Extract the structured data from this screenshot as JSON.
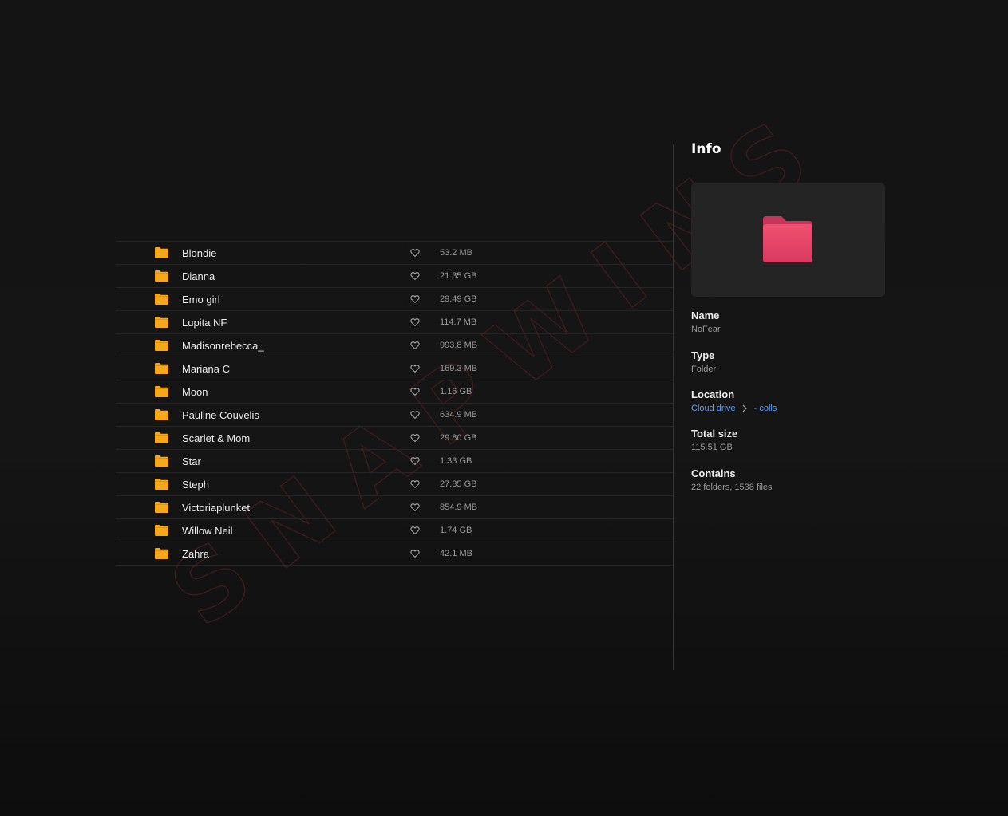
{
  "files": [
    {
      "name": "Blondie",
      "size": "53.2 MB"
    },
    {
      "name": "Dianna",
      "size": "21.35 GB"
    },
    {
      "name": "Emo girl",
      "size": "29.49 GB"
    },
    {
      "name": "Lupita NF",
      "size": "114.7 MB"
    },
    {
      "name": "Madisonrebecca_",
      "size": "993.8 MB"
    },
    {
      "name": "Mariana C",
      "size": "169.3 MB"
    },
    {
      "name": "Moon",
      "size": "1.16 GB"
    },
    {
      "name": "Pauline Couvelis",
      "size": "634.9 MB"
    },
    {
      "name": "Scarlet & Mom",
      "size": "29.80 GB"
    },
    {
      "name": "Star",
      "size": "1.33 GB"
    },
    {
      "name": "Steph",
      "size": "27.85 GB"
    },
    {
      "name": "Victoriaplunket",
      "size": "854.9 MB"
    },
    {
      "name": "Willow Neil",
      "size": "1.74 GB"
    },
    {
      "name": "Zahra",
      "size": "42.1 MB"
    }
  ],
  "icons": {
    "row_folder": "folder-icon",
    "row_favorite": "heart-icon",
    "preview": "folder-icon",
    "location_separator": "chevron-right-icon"
  },
  "info": {
    "title": "Info",
    "name_label": "Name",
    "name_value": "NoFear",
    "type_label": "Type",
    "type_value": "Folder",
    "location_label": "Location",
    "location_path": [
      "Cloud drive",
      "- colls"
    ],
    "total_size_label": "Total size",
    "total_size_value": "115.51 GB",
    "contains_label": "Contains",
    "contains_value": "22 folders, 1538 files"
  },
  "watermark": "SNAPWINS",
  "colors": {
    "background": "#141414",
    "row_folder": "#f5a81c",
    "preview_folder": "#e8436a",
    "link": "#5b9dff",
    "watermark_stroke": "#3a1d1d"
  }
}
